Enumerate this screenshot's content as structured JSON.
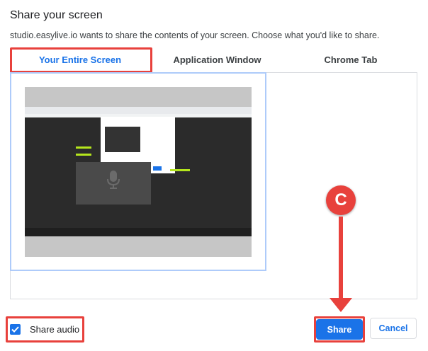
{
  "dialog": {
    "title": "Share your screen",
    "subtitle": "studio.easylive.io wants to share the contents of your screen. Choose what you'd like to share."
  },
  "tabs": [
    {
      "label": "Your Entire Screen",
      "active": true
    },
    {
      "label": "Application Window",
      "active": false
    },
    {
      "label": "Chrome Tab",
      "active": false
    }
  ],
  "audio": {
    "label": "Share audio",
    "checked": true
  },
  "buttons": {
    "share": "Share",
    "cancel": "Cancel"
  },
  "annotation": {
    "marker": "C"
  },
  "colors": {
    "accent": "#1a73e8",
    "annotation": "#e8413c"
  }
}
